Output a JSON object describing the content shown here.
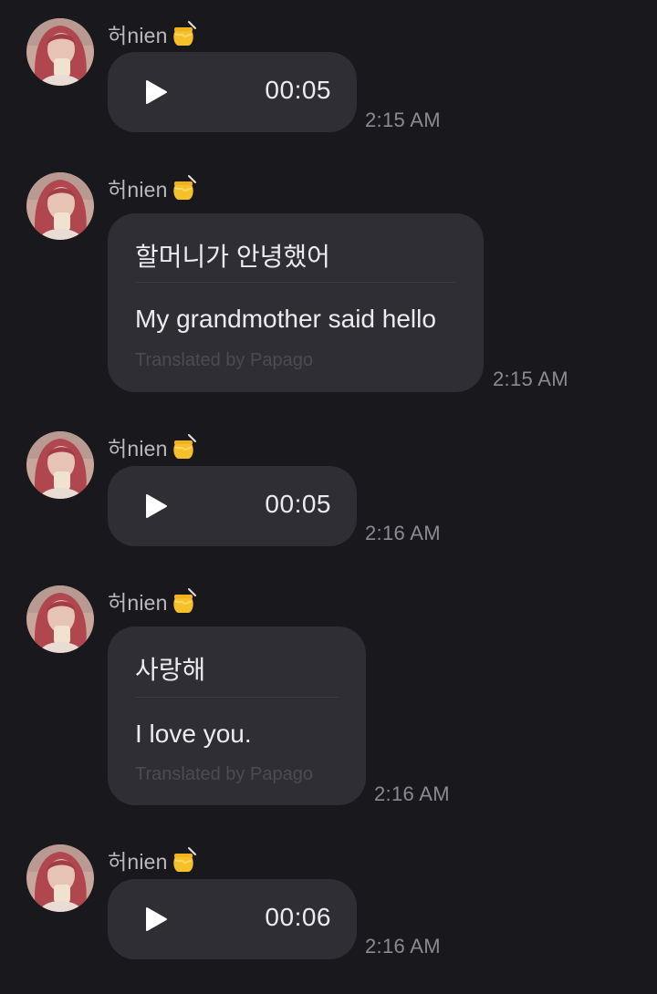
{
  "sender": {
    "name": "허nien",
    "badge_icon": "honey-pot-icon"
  },
  "colors": {
    "background": "#19181d",
    "bubble": "#2f2e34",
    "timestamp": "#8a8a90",
    "credit": "#4c4b52"
  },
  "messages": [
    {
      "type": "voice",
      "duration": "00:05",
      "time": "2:15 AM"
    },
    {
      "type": "text",
      "original": "할머니가 안녕했어",
      "translation": "My grandmother said hello",
      "credit": "Translated by Papago",
      "time": "2:15 AM"
    },
    {
      "type": "voice",
      "duration": "00:05",
      "time": "2:16 AM"
    },
    {
      "type": "text",
      "original": "사랑해",
      "translation": "I love you.",
      "credit": "Translated by Papago",
      "time": "2:16 AM"
    },
    {
      "type": "voice",
      "duration": "00:06",
      "time": "2:16 AM"
    }
  ]
}
